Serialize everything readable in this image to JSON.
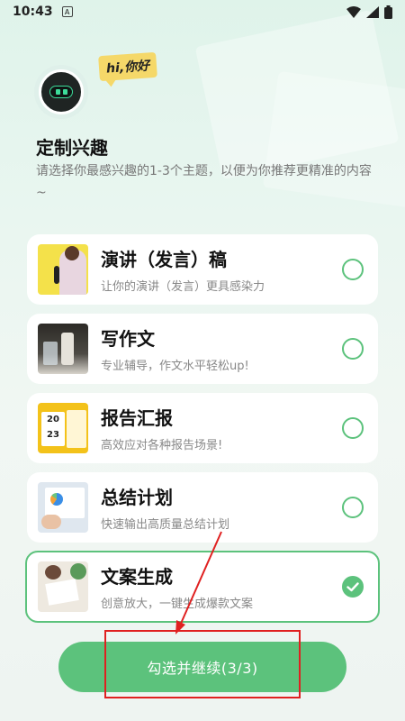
{
  "status_bar": {
    "time": "10:43",
    "notif_letter": "A"
  },
  "header": {
    "bubble_text": "hi,你好",
    "title": "定制兴趣",
    "subtitle": "请选择你最感兴趣的1-3个主题，以便为你推荐更精准的内容~"
  },
  "topics": [
    {
      "title": "演讲（发言）稿",
      "desc": "让你的演讲（发言）更具感染力",
      "selected": false
    },
    {
      "title": "写作文",
      "desc": "专业辅导，作文水平轻松up!",
      "selected": false
    },
    {
      "title": "报告汇报",
      "desc": "高效应对各种报告场景!",
      "selected": false
    },
    {
      "title": "总结计划",
      "desc": "快速输出高质量总结计划",
      "selected": false
    },
    {
      "title": "文案生成",
      "desc": "创意放大，一键生成爆款文案",
      "selected": true
    }
  ],
  "calendar_text": {
    "line1": "20",
    "line2": "23"
  },
  "continue_button": {
    "label": "勾选并继续(3/3)"
  },
  "colors": {
    "accent": "#5cc27c",
    "annotation": "#e02020"
  },
  "icons": [
    "wifi-icon",
    "signal-icon",
    "battery-icon",
    "robot-avatar-icon",
    "check-icon"
  ]
}
